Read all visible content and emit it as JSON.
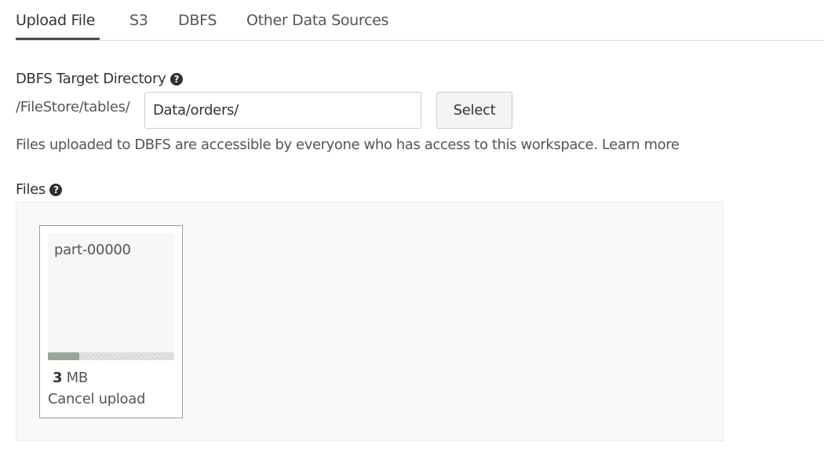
{
  "tabs": [
    {
      "label": "Upload File",
      "active": true
    },
    {
      "label": "S3",
      "active": false
    },
    {
      "label": "DBFS",
      "active": false
    },
    {
      "label": "Other Data Sources",
      "active": false
    }
  ],
  "target_directory": {
    "label": "DBFS Target Directory",
    "help_icon": "question-circle-icon",
    "help_glyph": "?",
    "prefix": "/FileStore/tables/",
    "value": "Data/orders/",
    "select_label": "Select"
  },
  "info": {
    "text": "Files uploaded to DBFS are accessible by everyone who has access to this workspace.",
    "link": "Learn more"
  },
  "files": {
    "label": "Files",
    "help_glyph": "?",
    "items": [
      {
        "name": "part-00000",
        "size_value": "3",
        "size_unit": "MB",
        "progress": 0.25,
        "cancel_label": "Cancel upload"
      }
    ]
  },
  "colors": {
    "tab_active_underline": "#4c4c4c",
    "progress_fill": "#9aa49a"
  }
}
